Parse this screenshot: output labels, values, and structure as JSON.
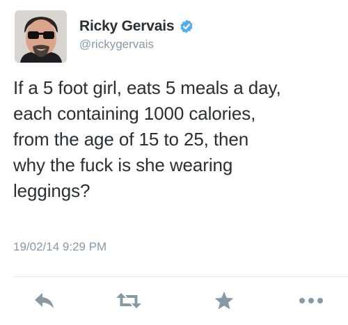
{
  "user": {
    "display_name": "Ricky Gervais",
    "handle": "@rickygervais",
    "verified": true,
    "verified_color": "#55acee"
  },
  "tweet": {
    "lines": [
      "If a 5 foot girl, eats 5 meals a day,",
      "each containing 1000 calories,",
      "from the age of 15 to 25, then",
      "why the fuck is she wearing",
      "leggings?"
    ],
    "timestamp": "19/02/14 9:29 PM"
  },
  "actions": {
    "icons": [
      "reply-icon",
      "retweet-icon",
      "favorite-icon",
      "more-icon"
    ],
    "icon_color": "#8899a6"
  }
}
